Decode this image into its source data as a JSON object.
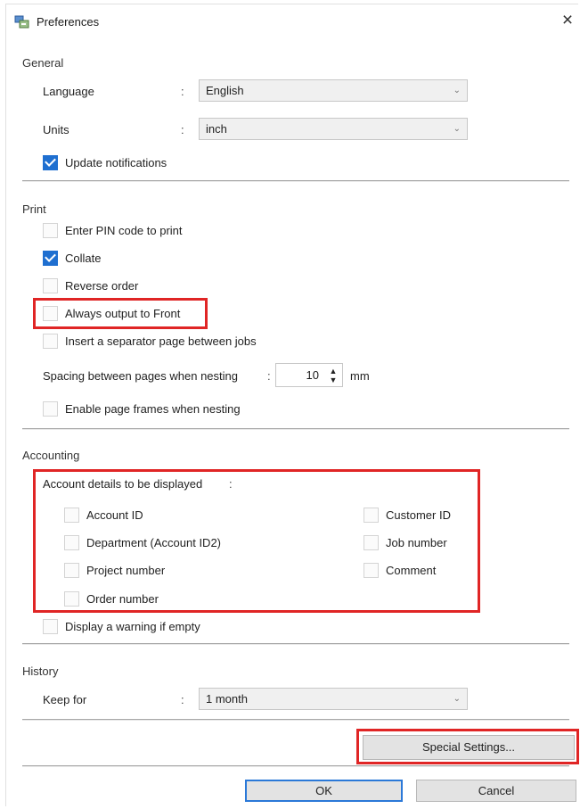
{
  "window": {
    "title": "Preferences",
    "close_symbol": "×",
    "title_icon": "preferences-app-icon"
  },
  "general": {
    "heading": "General",
    "language": {
      "label": "Language",
      "colon": ":",
      "value": "English"
    },
    "units": {
      "label": "Units",
      "colon": ":",
      "value": "inch"
    },
    "update_notifications": {
      "label": "Update notifications",
      "checked": true
    }
  },
  "print": {
    "heading": "Print",
    "options": [
      {
        "label": "Enter PIN code to print",
        "checked": false
      },
      {
        "label": "Collate",
        "checked": true
      },
      {
        "label": "Reverse order",
        "checked": false
      },
      {
        "label": "Always output to Front",
        "checked": false,
        "highlighted": true
      },
      {
        "label": "Insert a separator page between jobs",
        "checked": false
      }
    ],
    "spacing": {
      "label": "Spacing between pages when nesting",
      "colon": ":",
      "value": "10",
      "unit": "mm"
    },
    "page_frames": {
      "label": "Enable page frames when nesting",
      "checked": false
    }
  },
  "accounting": {
    "heading": "Accounting",
    "details_label": "Account details to be displayed",
    "colon": ":",
    "left_items": [
      {
        "label": "Account ID",
        "checked": false
      },
      {
        "label": "Department (Account ID2)",
        "checked": false
      },
      {
        "label": "Project number",
        "checked": false
      },
      {
        "label": "Order number",
        "checked": false
      }
    ],
    "right_items": [
      {
        "label": "Customer ID",
        "checked": false
      },
      {
        "label": "Job number",
        "checked": false
      },
      {
        "label": "Comment",
        "checked": false
      }
    ],
    "warning": {
      "label": "Display a warning if empty",
      "checked": false
    }
  },
  "history": {
    "heading": "History",
    "keep_for": {
      "label": "Keep for",
      "colon": ":",
      "value": "1 month"
    }
  },
  "buttons": {
    "special_settings": "Special Settings...",
    "ok": "OK",
    "cancel": "Cancel"
  },
  "colors": {
    "highlight_box": "#e02525",
    "checkbox_checked": "#1f6fd0",
    "default_button_border": "#2b79d8"
  }
}
